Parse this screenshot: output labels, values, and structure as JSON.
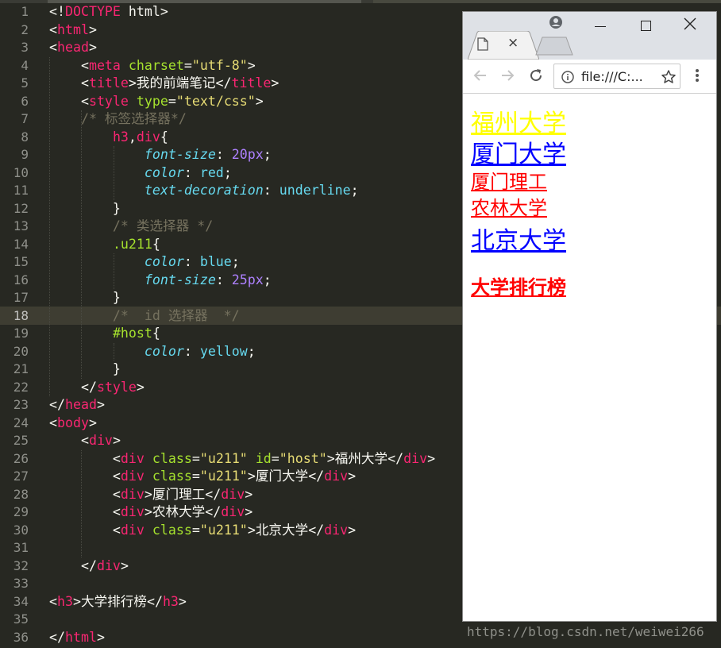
{
  "editor": {
    "active_line": 18,
    "lines": [
      {
        "n": "1",
        "tokens": [
          [
            "pun",
            "<!"
          ],
          [
            "tag",
            "DOCTYPE"
          ],
          [
            "pun",
            " html>"
          ]
        ]
      },
      {
        "n": "2",
        "tokens": [
          [
            "pun",
            "<"
          ],
          [
            "tag",
            "html"
          ],
          [
            "pun",
            ">"
          ]
        ]
      },
      {
        "n": "3",
        "tokens": [
          [
            "pun",
            "<"
          ],
          [
            "tag",
            "head"
          ],
          [
            "pun",
            ">"
          ]
        ]
      },
      {
        "n": "4",
        "tokens": [
          [
            "pun",
            "    <"
          ],
          [
            "tag",
            "meta"
          ],
          [
            "pun",
            " "
          ],
          [
            "attr",
            "charset"
          ],
          [
            "pun",
            "="
          ],
          [
            "str",
            "\"utf-8\""
          ],
          [
            "pun",
            ">"
          ]
        ]
      },
      {
        "n": "5",
        "tokens": [
          [
            "pun",
            "    <"
          ],
          [
            "tag",
            "title"
          ],
          [
            "pun",
            ">"
          ],
          [
            "zh",
            "我的前端笔记"
          ],
          [
            "pun",
            "</"
          ],
          [
            "tag",
            "title"
          ],
          [
            "pun",
            ">"
          ]
        ]
      },
      {
        "n": "6",
        "tokens": [
          [
            "pun",
            "    <"
          ],
          [
            "tag",
            "style"
          ],
          [
            "pun",
            " "
          ],
          [
            "attr",
            "type"
          ],
          [
            "pun",
            "="
          ],
          [
            "str",
            "\"text/css\""
          ],
          [
            "pun",
            ">"
          ]
        ]
      },
      {
        "n": "7",
        "tokens": [
          [
            "com",
            "    /* 标签选择器*/"
          ]
        ]
      },
      {
        "n": "8",
        "tokens": [
          [
            "pun",
            "        "
          ],
          [
            "sel",
            "h3"
          ],
          [
            "pun",
            ","
          ],
          [
            "sel",
            "div"
          ],
          [
            "pun",
            "{"
          ]
        ]
      },
      {
        "n": "9",
        "tokens": [
          [
            "pun",
            "            "
          ],
          [
            "prop",
            "font-size"
          ],
          [
            "pun",
            ": "
          ],
          [
            "num",
            "20px"
          ],
          [
            "pun",
            ";"
          ]
        ]
      },
      {
        "n": "10",
        "tokens": [
          [
            "pun",
            "            "
          ],
          [
            "prop",
            "color"
          ],
          [
            "pun",
            ": "
          ],
          [
            "val",
            "red"
          ],
          [
            "pun",
            ";"
          ]
        ]
      },
      {
        "n": "11",
        "tokens": [
          [
            "pun",
            "            "
          ],
          [
            "prop",
            "text-decoration"
          ],
          [
            "pun",
            ": "
          ],
          [
            "val",
            "underline"
          ],
          [
            "pun",
            ";"
          ]
        ]
      },
      {
        "n": "12",
        "tokens": [
          [
            "pun",
            "        }"
          ]
        ]
      },
      {
        "n": "13",
        "tokens": [
          [
            "com",
            "        /* 类选择器 */"
          ]
        ]
      },
      {
        "n": "14",
        "tokens": [
          [
            "pun",
            "        "
          ],
          [
            "id",
            ".u211"
          ],
          [
            "pun",
            "{"
          ]
        ]
      },
      {
        "n": "15",
        "tokens": [
          [
            "pun",
            "            "
          ],
          [
            "prop",
            "color"
          ],
          [
            "pun",
            ": "
          ],
          [
            "val",
            "blue"
          ],
          [
            "pun",
            ";"
          ]
        ]
      },
      {
        "n": "16",
        "tokens": [
          [
            "pun",
            "            "
          ],
          [
            "prop",
            "font-size"
          ],
          [
            "pun",
            ": "
          ],
          [
            "num",
            "25px"
          ],
          [
            "pun",
            ";"
          ]
        ]
      },
      {
        "n": "17",
        "tokens": [
          [
            "pun",
            "        }"
          ]
        ]
      },
      {
        "n": "18",
        "tokens": [
          [
            "com",
            "        /*  id 选择器  */"
          ]
        ]
      },
      {
        "n": "19",
        "tokens": [
          [
            "pun",
            "        "
          ],
          [
            "id",
            "#host"
          ],
          [
            "pun",
            "{"
          ]
        ]
      },
      {
        "n": "20",
        "tokens": [
          [
            "pun",
            "            "
          ],
          [
            "prop",
            "color"
          ],
          [
            "pun",
            ": "
          ],
          [
            "val",
            "yellow"
          ],
          [
            "pun",
            ";"
          ]
        ]
      },
      {
        "n": "21",
        "tokens": [
          [
            "pun",
            "        }"
          ]
        ]
      },
      {
        "n": "22",
        "tokens": [
          [
            "pun",
            "    </"
          ],
          [
            "tag",
            "style"
          ],
          [
            "pun",
            ">"
          ]
        ]
      },
      {
        "n": "23",
        "tokens": [
          [
            "pun",
            "</"
          ],
          [
            "tag",
            "head"
          ],
          [
            "pun",
            ">"
          ]
        ]
      },
      {
        "n": "24",
        "tokens": [
          [
            "pun",
            "<"
          ],
          [
            "tag",
            "body"
          ],
          [
            "pun",
            ">"
          ]
        ]
      },
      {
        "n": "25",
        "tokens": [
          [
            "pun",
            "    <"
          ],
          [
            "tag",
            "div"
          ],
          [
            "pun",
            ">"
          ]
        ]
      },
      {
        "n": "26",
        "tokens": [
          [
            "pun",
            "        <"
          ],
          [
            "tag",
            "div"
          ],
          [
            "pun",
            " "
          ],
          [
            "attr",
            "class"
          ],
          [
            "pun",
            "="
          ],
          [
            "str",
            "\"u211\""
          ],
          [
            "pun",
            " "
          ],
          [
            "attr",
            "id"
          ],
          [
            "pun",
            "="
          ],
          [
            "str",
            "\"host\""
          ],
          [
            "pun",
            ">"
          ],
          [
            "zh",
            "福州大学"
          ],
          [
            "pun",
            "</"
          ],
          [
            "tag",
            "div"
          ],
          [
            "pun",
            ">"
          ]
        ]
      },
      {
        "n": "27",
        "tokens": [
          [
            "pun",
            "        <"
          ],
          [
            "tag",
            "div"
          ],
          [
            "pun",
            " "
          ],
          [
            "attr",
            "class"
          ],
          [
            "pun",
            "="
          ],
          [
            "str",
            "\"u211\""
          ],
          [
            "pun",
            ">"
          ],
          [
            "zh",
            "厦门大学"
          ],
          [
            "pun",
            "</"
          ],
          [
            "tag",
            "div"
          ],
          [
            "pun",
            ">"
          ]
        ]
      },
      {
        "n": "28",
        "tokens": [
          [
            "pun",
            "        <"
          ],
          [
            "tag",
            "div"
          ],
          [
            "pun",
            ">"
          ],
          [
            "zh",
            "厦门理工"
          ],
          [
            "pun",
            "</"
          ],
          [
            "tag",
            "div"
          ],
          [
            "pun",
            ">"
          ]
        ]
      },
      {
        "n": "29",
        "tokens": [
          [
            "pun",
            "        <"
          ],
          [
            "tag",
            "div"
          ],
          [
            "pun",
            ">"
          ],
          [
            "zh",
            "农林大学"
          ],
          [
            "pun",
            "</"
          ],
          [
            "tag",
            "div"
          ],
          [
            "pun",
            ">"
          ]
        ]
      },
      {
        "n": "30",
        "tokens": [
          [
            "pun",
            "        <"
          ],
          [
            "tag",
            "div"
          ],
          [
            "pun",
            " "
          ],
          [
            "attr",
            "class"
          ],
          [
            "pun",
            "="
          ],
          [
            "str",
            "\"u211\""
          ],
          [
            "pun",
            ">"
          ],
          [
            "zh",
            "北京大学"
          ],
          [
            "pun",
            "</"
          ],
          [
            "tag",
            "div"
          ],
          [
            "pun",
            ">"
          ]
        ]
      },
      {
        "n": "31",
        "tokens": []
      },
      {
        "n": "32",
        "tokens": [
          [
            "pun",
            "    </"
          ],
          [
            "tag",
            "div"
          ],
          [
            "pun",
            ">"
          ]
        ]
      },
      {
        "n": "33",
        "tokens": []
      },
      {
        "n": "34",
        "tokens": [
          [
            "pun",
            "<"
          ],
          [
            "tag",
            "h3"
          ],
          [
            "pun",
            ">"
          ],
          [
            "zh",
            "大学排行榜"
          ],
          [
            "pun",
            "</"
          ],
          [
            "tag",
            "h3"
          ],
          [
            "pun",
            ">"
          ]
        ]
      },
      {
        "n": "35",
        "tokens": []
      },
      {
        "n": "36",
        "tokens": [
          [
            "pun",
            "</"
          ],
          [
            "tag",
            "html"
          ],
          [
            "pun",
            ">"
          ]
        ]
      }
    ]
  },
  "browser": {
    "tab_close": "×",
    "url": "file:///C:...",
    "page": [
      {
        "text": "福州大学",
        "style": "yellow"
      },
      {
        "text": "厦门大学",
        "style": "blue"
      },
      {
        "text": "厦门理工",
        "style": "red"
      },
      {
        "text": "农林大学",
        "style": "red"
      },
      {
        "text": "北京大学",
        "style": "blue"
      },
      {
        "text": "大学排行榜",
        "style": "h3"
      }
    ]
  },
  "watermark": "https://blog.csdn.net/weiwei266",
  "colors": {
    "editor_bg": "#272822",
    "tag": "#f92672",
    "attr": "#a6e22e",
    "string": "#e6db74",
    "comment": "#75715e",
    "property": "#66d9ef",
    "number": "#ae81ff"
  }
}
